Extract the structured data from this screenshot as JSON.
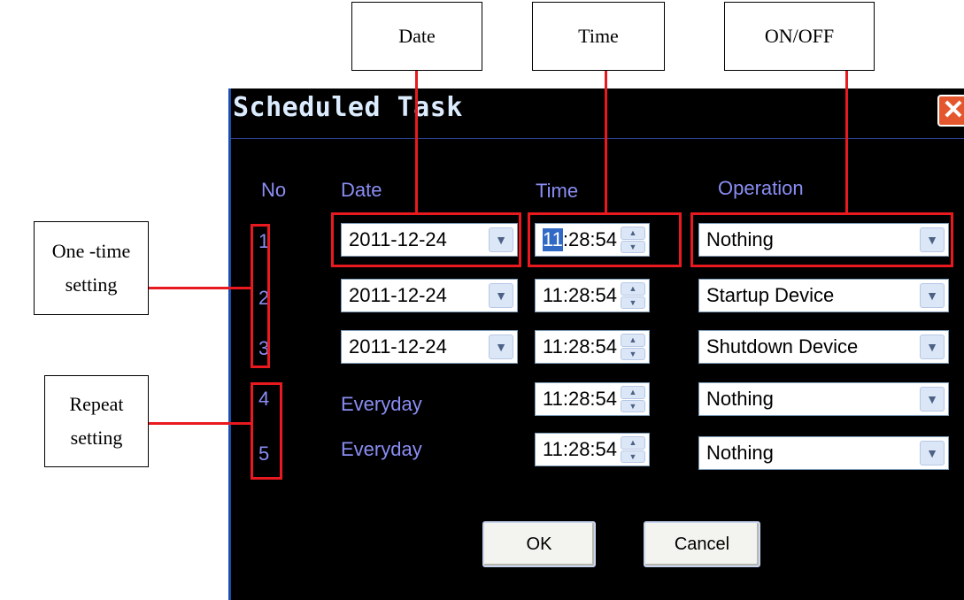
{
  "callouts": {
    "date": "Date",
    "time": "Time",
    "on_off": "ON/OFF",
    "one_time_line1": "One -time",
    "one_time_line2": "setting",
    "repeat_line1": "Repeat",
    "repeat_line2": "setting"
  },
  "dialog": {
    "title": "Scheduled Task",
    "close_glyph": "✕",
    "headers": {
      "no": "No",
      "date": "Date",
      "time": "Time",
      "operation": "Operation"
    },
    "rows": [
      {
        "no": "1",
        "date": "2011-12-24",
        "time_hour": "11",
        "time_rest": ":28:54",
        "operation": "Nothing"
      },
      {
        "no": "2",
        "date": "2011-12-24",
        "time_hour": "11",
        "time_rest": ":28:54",
        "operation": "Startup Device"
      },
      {
        "no": "3",
        "date": "2011-12-24",
        "time_hour": "11",
        "time_rest": ":28:54",
        "operation": "Shutdown Device"
      },
      {
        "no": "4",
        "date": "Everyday",
        "time_hour": "11",
        "time_rest": ":28:54",
        "operation": "Nothing"
      },
      {
        "no": "5",
        "date": "Everyday",
        "time_hour": "11",
        "time_rest": ":28:54",
        "operation": "Nothing"
      }
    ],
    "ok_label": "OK",
    "cancel_label": "Cancel"
  },
  "icons": {
    "combo_arrow": "chevron-down-icon",
    "spin_up": "spin-up-icon",
    "spin_down": "spin-down-icon",
    "close": "close-icon"
  },
  "colors": {
    "annotation_red": "#e8191f",
    "dialog_bg": "#000000",
    "header_text": "#8a8ef4",
    "close_button": "#e4572e"
  }
}
